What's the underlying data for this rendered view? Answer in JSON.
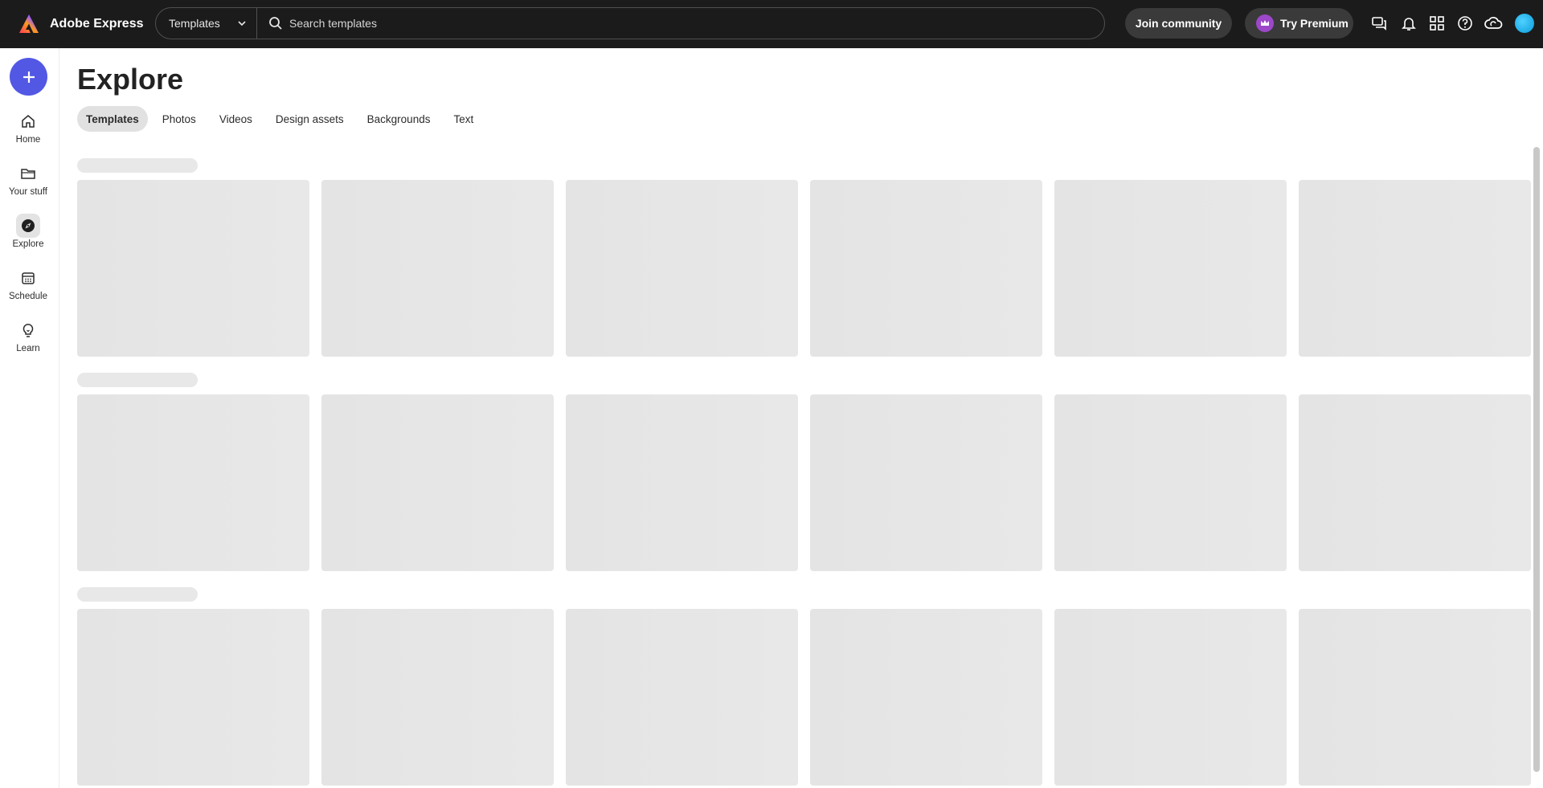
{
  "header": {
    "app_name": "Adobe Express",
    "search_scope": "Templates",
    "search_placeholder": "Search templates",
    "join_label": "Join community",
    "premium_label": "Try Premium",
    "icons": [
      "chat-icon",
      "bell-icon",
      "apps-grid-icon",
      "help-icon",
      "creative-cloud-icon",
      "avatar"
    ]
  },
  "sidebar": {
    "items": [
      {
        "label": "Home",
        "icon": "home-icon"
      },
      {
        "label": "Your stuff",
        "icon": "folder-icon"
      },
      {
        "label": "Explore",
        "icon": "explore-icon"
      },
      {
        "label": "Schedule",
        "icon": "calendar-icon"
      },
      {
        "label": "Learn",
        "icon": "lightbulb-icon"
      }
    ],
    "active": "Explore"
  },
  "main": {
    "title": "Explore",
    "tabs": [
      {
        "label": "Templates",
        "active": true
      },
      {
        "label": "Photos"
      },
      {
        "label": "Videos"
      },
      {
        "label": "Design assets"
      },
      {
        "label": "Backgrounds"
      },
      {
        "label": "Text"
      }
    ],
    "loading_rows": 3,
    "cards_per_row": 6
  },
  "colors": {
    "topbar": "#1b1b1b",
    "create_button": "#5258e4",
    "premium_crown": "#9c48c9",
    "skeleton": "#e6e6e6"
  }
}
